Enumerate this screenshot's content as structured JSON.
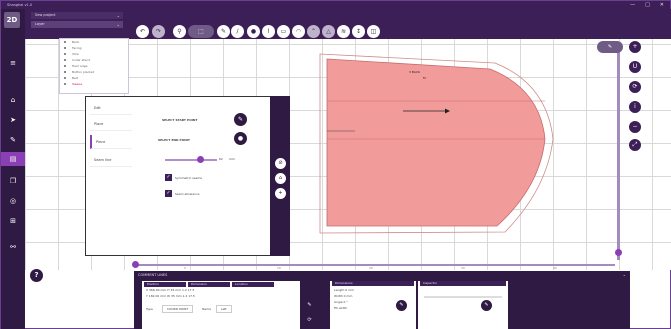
{
  "window": {
    "title": "Shanghai v1.0",
    "controls": [
      "—",
      "□",
      "✕"
    ]
  },
  "logo": "2D",
  "toolbar": {
    "dropdown1": "Sew project",
    "dropdown2": "Layer",
    "buttons": [
      "undo",
      "redo",
      "pin",
      "select",
      "pen",
      "knife",
      "circle",
      "polyline",
      "rect",
      "arc",
      "notch",
      "dart",
      "pleat",
      "grain",
      "measure",
      "settings"
    ]
  },
  "layers": {
    "items": [
      "Back",
      "Facing",
      "Yoke",
      "Collar stand",
      "Hem edge",
      "Button placket",
      "Belt",
      "Sleeve"
    ],
    "selected_index": 7
  },
  "panel": {
    "tabs": [
      "Edit",
      "Place",
      "Piece",
      "Seam line"
    ],
    "active_tab": 2,
    "pick_start_label": "SELECT START POINT",
    "pick_end_label": "SELECT END POINT",
    "slider_value": "62",
    "slider_unit": "mm",
    "checkbox1": "Symmetric seams",
    "checkbox2": "Seam allowance"
  },
  "canvas": {
    "label_tag": "3 BACK",
    "label_size": "M",
    "fill_color": "#f29b9b",
    "grid_color": "#d9d9d9"
  },
  "hslider": {
    "ticks": [
      "0",
      "10",
      "20",
      "30",
      "40"
    ]
  },
  "bottom": {
    "title": "COMMENT LINES",
    "sec1": {
      "heads": [
        "Position",
        "Dimension",
        "Location"
      ],
      "rows": [
        "X 366.00 mm  H 34 mm  1.2 17.5",
        "Y 182.00 mm  W 35 mm  1.2 17.5"
      ],
      "type_label": "Type",
      "type_value": "COORD POINT",
      "name_label": "Name",
      "name_value": "Left"
    },
    "sec2": {
      "head": "Dimensions",
      "rows": [
        "Length 0 mm",
        "Width 0 mm",
        "Angle 0 °",
        "Fill width"
      ]
    },
    "sec3": {
      "head": "Inspector"
    }
  },
  "colors": {
    "accent": "#8a3fb4",
    "dark": "#2e1a42",
    "toolbar": "#3c1f56",
    "shape": "#f29b9b"
  }
}
